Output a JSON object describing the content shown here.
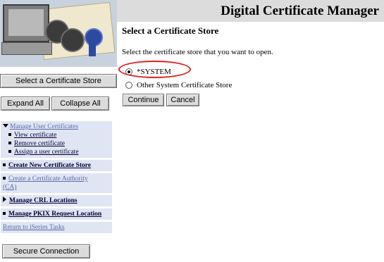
{
  "app": {
    "title": "Digital Certificate Manager"
  },
  "sidebar": {
    "select_store_label": "Select a Certificate Store",
    "expand_all_label": "Expand All",
    "collapse_all_label": "Collapse All",
    "manage_user_certs": {
      "label": "Manage User Certificates",
      "children": [
        "View certificate",
        "Remove certificate",
        "Assign a user certificate"
      ]
    },
    "create_new_store_label": "Create New Certificate Store",
    "create_ca_label_line1": "Create a Certificate Authority",
    "create_ca_label_line2": "(CA)",
    "manage_crl_label": "Manage CRL Locations",
    "manage_pkix_label": "Manage PKIX Request Location",
    "return_label": "Return to iSeries Tasks",
    "secure_connection_label": "Secure Connection"
  },
  "main": {
    "heading": "Select a Certificate Store",
    "instructions": "Select the certificate store that you want to open.",
    "options": [
      {
        "label": "*SYSTEM",
        "selected": true
      },
      {
        "label": "Other System Certificate Store",
        "selected": false
      }
    ],
    "continue_label": "Continue",
    "cancel_label": "Cancel"
  },
  "colors": {
    "title_bar": "#dcdcdc",
    "nav_box": "#dfe5f3",
    "highlight": "#e02020"
  }
}
